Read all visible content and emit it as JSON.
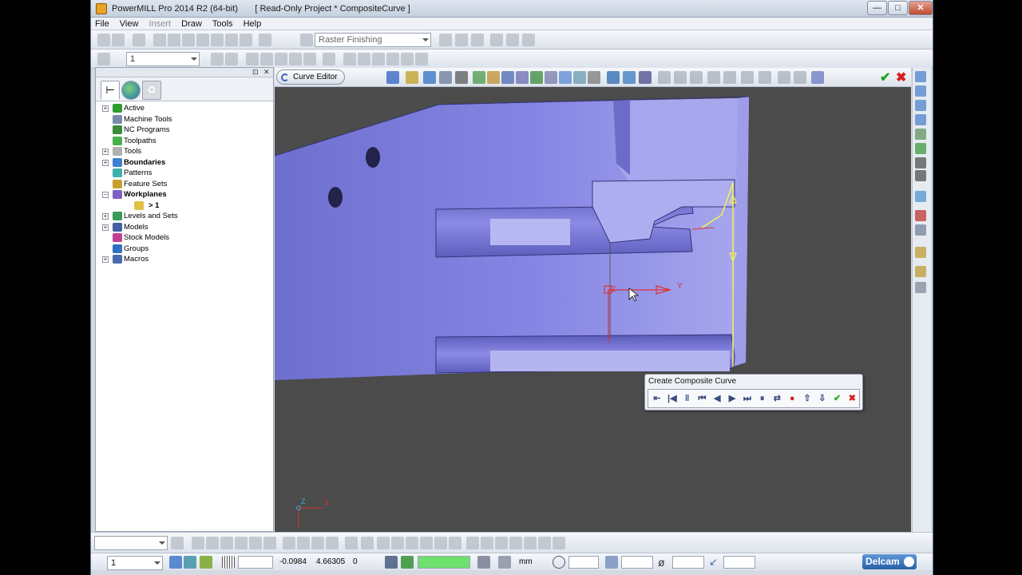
{
  "titlebar": {
    "title": "PowerMILL Pro 2014 R2 (64-bit)       [ Read-Only Project * CompositeCurve ]",
    "minimize": "—",
    "maximize": "□",
    "close": "✕"
  },
  "menu": {
    "items": [
      {
        "label": "File"
      },
      {
        "label": "View"
      },
      {
        "label": "Insert"
      },
      {
        "label": "Draw"
      },
      {
        "label": "Tools"
      },
      {
        "label": "Help"
      }
    ]
  },
  "toolbar1": {
    "strategy_combo": "Raster Finishing"
  },
  "toolbar2": {
    "combo_value": "1"
  },
  "explorer": {
    "pin": "⊡",
    "close": "✕",
    "tabs": [
      "tree",
      "globe",
      "recycle"
    ],
    "items": [
      {
        "label": "Active",
        "icon_color": "#2f9b2f",
        "bold": false,
        "expander": "+"
      },
      {
        "label": "Machine Tools",
        "icon_color": "#7a8aa8",
        "bold": false,
        "expander": ""
      },
      {
        "label": "NC Programs",
        "icon_color": "#3a8a3a",
        "bold": false,
        "expander": ""
      },
      {
        "label": "Toolpaths",
        "icon_color": "#4bb04b",
        "bold": false,
        "expander": ""
      },
      {
        "label": "Tools",
        "icon_color": "#b0b0b0",
        "bold": false,
        "expander": "+"
      },
      {
        "label": "Boundaries",
        "icon_color": "#3d7fd0",
        "bold": true,
        "expander": "+"
      },
      {
        "label": "Patterns",
        "icon_color": "#3db0b0",
        "bold": false,
        "expander": ""
      },
      {
        "label": "Feature Sets",
        "icon_color": "#c8a030",
        "bold": false,
        "expander": ""
      },
      {
        "label": "Workplanes",
        "icon_color": "#8060c0",
        "bold": true,
        "expander": "−"
      },
      {
        "label": "> 1",
        "icon_color": "#e0c040",
        "bold": true,
        "expander": "",
        "indent": true
      },
      {
        "label": "Levels and Sets",
        "icon_color": "#3a9a5a",
        "bold": false,
        "expander": "+"
      },
      {
        "label": "Models",
        "icon_color": "#4060a0",
        "bold": false,
        "expander": "+"
      },
      {
        "label": "Stock Models",
        "icon_color": "#c04090",
        "bold": false,
        "expander": ""
      },
      {
        "label": "Groups",
        "icon_color": "#3070c0",
        "bold": false,
        "expander": ""
      },
      {
        "label": "Macros",
        "icon_color": "#4a6ab0",
        "bold": false,
        "expander": "+"
      }
    ]
  },
  "curve_editor": {
    "label": "Curve Editor",
    "accept": "✔",
    "cancel": "✖"
  },
  "viewport": {
    "axis_y": "Y",
    "axis_z": "Z",
    "triad_x": "X",
    "triad_z": "Z",
    "colors": {
      "background": "#4b4b4b",
      "model": "#7b7bd6",
      "workplane": "#e03030",
      "curve": "#f2ef5a"
    }
  },
  "dialog": {
    "title": "Create Composite Curve",
    "buttons": [
      "⇤",
      "|◀",
      "‖",
      "⏮",
      "◀",
      "▶",
      "⏭",
      "⏸",
      "⇄",
      "●",
      "⇧",
      "⇩",
      "✔",
      "✖"
    ]
  },
  "status": {
    "workplane_combo": "1",
    "coord_x": "-0.0984",
    "coord_y": "4.66305",
    "coord_z": "0",
    "units": "mm",
    "progress": 1.0,
    "logo": "Delcam"
  }
}
